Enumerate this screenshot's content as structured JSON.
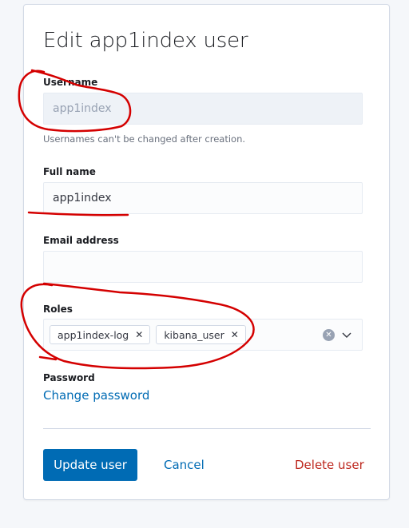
{
  "form": {
    "title": "Edit app1index user",
    "username": {
      "label": "Username",
      "value": "app1index",
      "help": "Usernames can't be changed after creation."
    },
    "full_name": {
      "label": "Full name",
      "value": "app1index"
    },
    "email": {
      "label": "Email address",
      "value": ""
    },
    "roles": {
      "label": "Roles",
      "items": [
        "app1index-log",
        "kibana_user"
      ],
      "remove_glyph": "✕",
      "clear_glyph": "✕"
    },
    "password": {
      "label": "Password",
      "link": "Change password"
    },
    "actions": {
      "update": "Update user",
      "cancel": "Cancel",
      "delete": "Delete user"
    }
  },
  "colors": {
    "primary": "#006bb4",
    "danger": "#bd271e",
    "annotation": "#d40000"
  },
  "icons": {
    "clear": "clear-icon",
    "chevron": "chevron-down-icon",
    "remove": "close-icon"
  }
}
